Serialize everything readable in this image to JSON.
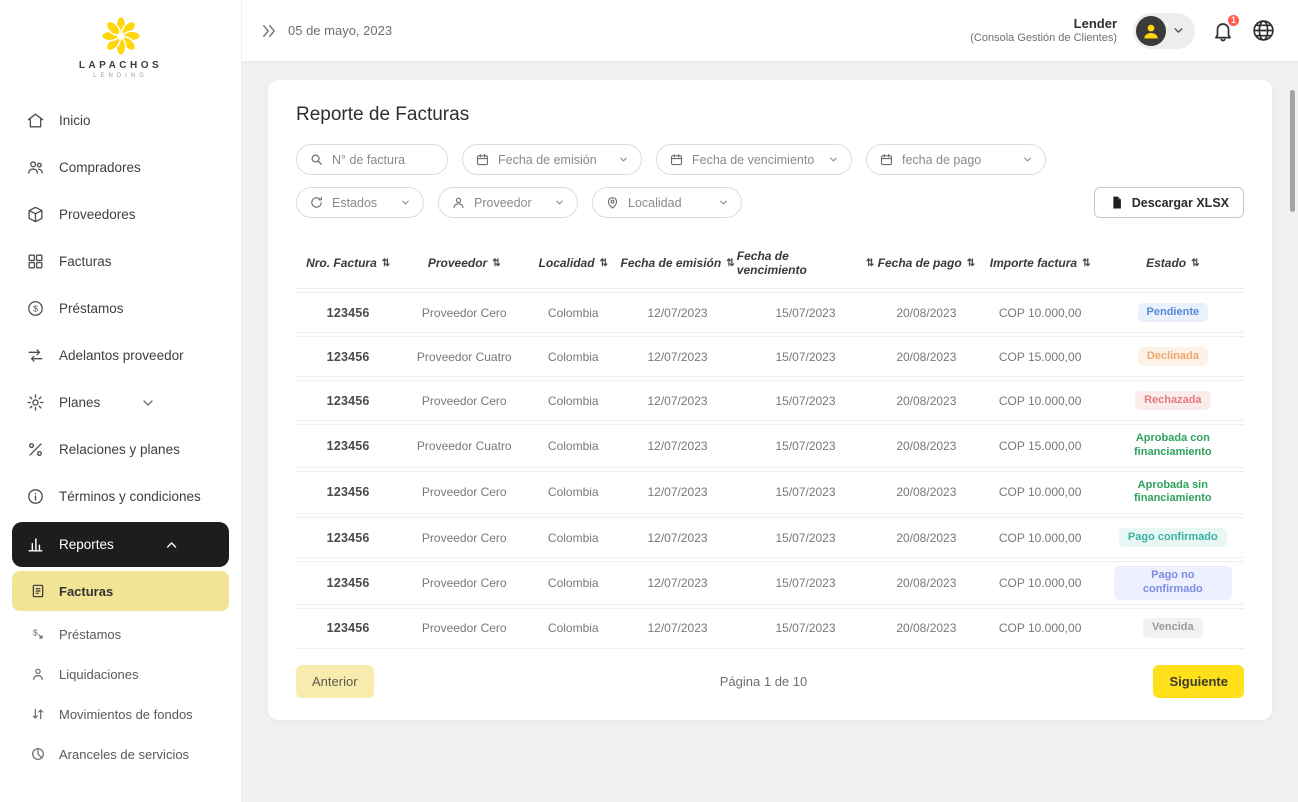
{
  "brand": {
    "name": "LAPACHOS",
    "sub": "LENDING"
  },
  "topbar": {
    "date": "05 de mayo, 2023",
    "user_name": "Lender",
    "user_console": "(Consola Gestión de Clientes)",
    "notification_count": "1"
  },
  "sidebar": {
    "items": [
      {
        "label": "Inicio"
      },
      {
        "label": "Compradores"
      },
      {
        "label": "Proveedores"
      },
      {
        "label": "Facturas"
      },
      {
        "label": "Préstamos"
      },
      {
        "label": "Adelantos proveedor"
      },
      {
        "label": "Planes"
      },
      {
        "label": "Relaciones y planes"
      },
      {
        "label": "Términos y condiciones"
      },
      {
        "label": "Reportes"
      }
    ],
    "sub_items": [
      {
        "label": "Facturas"
      },
      {
        "label": "Préstamos"
      },
      {
        "label": "Liquidaciones"
      },
      {
        "label": "Movimientos de fondos"
      },
      {
        "label": "Aranceles de servicios"
      }
    ]
  },
  "main": {
    "title": "Reporte de Facturas",
    "filters": {
      "invoice_placeholder": "N° de factura",
      "emission": "Fecha de emisión",
      "due": "Fecha de vencimiento",
      "payment": "fecha de pago",
      "states": "Estados",
      "provider": "Proveedor",
      "locality": "Localidad",
      "download": "Descargar XLSX"
    },
    "table": {
      "headers": [
        "Nro. Factura",
        "Proveedor",
        "Localidad",
        "Fecha de emisión",
        "Fecha de vencimiento",
        "Fecha de pago",
        "Importe factura",
        "Estado"
      ],
      "rows": [
        {
          "nro": "123456",
          "proveedor": "Proveedor Cero",
          "localidad": "Colombia",
          "emision": "12/07/2023",
          "vencimiento": "15/07/2023",
          "pago": "20/08/2023",
          "importe": "COP 10.000,00",
          "estado": "Pendiente",
          "estado_type": "pendiente"
        },
        {
          "nro": "123456",
          "proveedor": "Proveedor Cuatro",
          "localidad": "Colombia",
          "emision": "12/07/2023",
          "vencimiento": "15/07/2023",
          "pago": "20/08/2023",
          "importe": "COP 15.000,00",
          "estado": "Declinada",
          "estado_type": "declinada"
        },
        {
          "nro": "123456",
          "proveedor": "Proveedor Cero",
          "localidad": "Colombia",
          "emision": "12/07/2023",
          "vencimiento": "15/07/2023",
          "pago": "20/08/2023",
          "importe": "COP 10.000,00",
          "estado": "Rechazada",
          "estado_type": "rechazada"
        },
        {
          "nro": "123456",
          "proveedor": "Proveedor Cuatro",
          "localidad": "Colombia",
          "emision": "12/07/2023",
          "vencimiento": "15/07/2023",
          "pago": "20/08/2023",
          "importe": "COP 15.000,00",
          "estado": "Aprobada con financiamiento",
          "estado_type": "aprobada-con"
        },
        {
          "nro": "123456",
          "proveedor": "Proveedor Cero",
          "localidad": "Colombia",
          "emision": "12/07/2023",
          "vencimiento": "15/07/2023",
          "pago": "20/08/2023",
          "importe": "COP 10.000,00",
          "estado": "Aprobada sin financiamiento",
          "estado_type": "aprobada-sin"
        },
        {
          "nro": "123456",
          "proveedor": "Proveedor Cero",
          "localidad": "Colombia",
          "emision": "12/07/2023",
          "vencimiento": "15/07/2023",
          "pago": "20/08/2023",
          "importe": "COP 10.000,00",
          "estado": "Pago confirmado",
          "estado_type": "pago-confirmado"
        },
        {
          "nro": "123456",
          "proveedor": "Proveedor Cero",
          "localidad": "Colombia",
          "emision": "12/07/2023",
          "vencimiento": "15/07/2023",
          "pago": "20/08/2023",
          "importe": "COP 10.000,00",
          "estado": "Pago no confirmado",
          "estado_type": "pago-no-confirmado"
        },
        {
          "nro": "123456",
          "proveedor": "Proveedor Cero",
          "localidad": "Colombia",
          "emision": "12/07/2023",
          "vencimiento": "15/07/2023",
          "pago": "20/08/2023",
          "importe": "COP 10.000,00",
          "estado": "Vencida",
          "estado_type": "vencida"
        }
      ]
    },
    "pagination": {
      "prev": "Anterior",
      "info": "Página 1 de 10",
      "next": "Siguiente"
    }
  },
  "colors": {
    "brand_yellow": "#FFD60A",
    "next_button_yellow": "#FFE01A",
    "pale_yellow": "#F7ECAE",
    "active_item_dark": "#1D1D1D",
    "notification_red": "#FF5A4E",
    "approved_green": "#2FA25B"
  }
}
